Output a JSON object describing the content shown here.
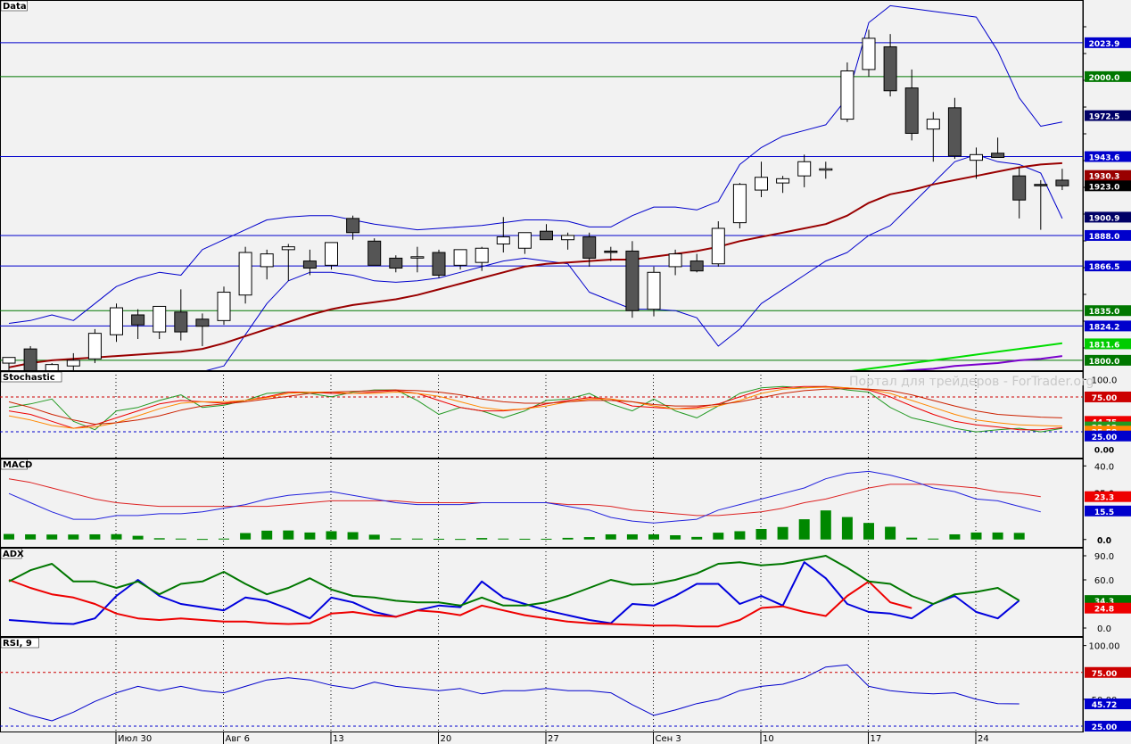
{
  "watermark": "Портал для трейдеров - ForTrader.org",
  "colors": {
    "bg": "#f2f2f2",
    "blue": "#0000cc",
    "green": "#007700",
    "red": "#cc0000",
    "darkred": "#990000",
    "candle_down": "#555555",
    "candle_up": "#ffffff",
    "purple": "#7a00cc",
    "lime": "#00dd00",
    "orange": "#ff8800"
  },
  "x_labels": [
    "Июл 30",
    "Авг 6",
    "13",
    "20",
    "27",
    "Сен 3",
    "10",
    "17",
    "24"
  ],
  "panels": [
    {
      "id": "price",
      "title": "Data",
      "ylim": [
        1793,
        2054
      ],
      "ticks": [],
      "hlines": [
        {
          "v": 2023.9,
          "c": "#0000cc"
        },
        {
          "v": 2000.0,
          "c": "#007700"
        },
        {
          "v": 1943.6,
          "c": "#0000cc"
        },
        {
          "v": 1888.0,
          "c": "#0000cc"
        },
        {
          "v": 1866.5,
          "c": "#0000cc"
        },
        {
          "v": 1835.0,
          "c": "#007700"
        },
        {
          "v": 1824.2,
          "c": "#0000cc"
        },
        {
          "v": 1800.0,
          "c": "#007700"
        }
      ],
      "tags": [
        {
          "text": "2023.9",
          "v": 2023.9,
          "bg": "#0000cc",
          "fg": "#ffffff"
        },
        {
          "text": "2000.0",
          "v": 2000.0,
          "bg": "#007700",
          "fg": "#ffffff"
        },
        {
          "text": "1972.5",
          "v": 1972.5,
          "bg": "#000066",
          "fg": "#ffffff"
        },
        {
          "text": "1943.6",
          "v": 1943.6,
          "bg": "#0000cc",
          "fg": "#ffffff"
        },
        {
          "text": "1930.3",
          "v": 1930.3,
          "bg": "#990000",
          "fg": "#ffffff"
        },
        {
          "text": "1923.0",
          "v": 1923.0,
          "bg": "#000000",
          "fg": "#ffffff"
        },
        {
          "text": "1900.9",
          "v": 1900.9,
          "bg": "#000066",
          "fg": "#ffffff"
        },
        {
          "text": "1888.0",
          "v": 1888.0,
          "bg": "#0000cc",
          "fg": "#ffffff"
        },
        {
          "text": "1866.5",
          "v": 1866.5,
          "bg": "#0000cc",
          "fg": "#ffffff"
        },
        {
          "text": "1835.0",
          "v": 1835.0,
          "bg": "#007700",
          "fg": "#ffffff"
        },
        {
          "text": "1824.2",
          "v": 1824.2,
          "bg": "#0000cc",
          "fg": "#ffffff"
        },
        {
          "text": "1811.6",
          "v": 1811.6,
          "bg": "#00cc00",
          "fg": "#ffffff"
        },
        {
          "text": "1800.0",
          "v": 1800.0,
          "bg": "#007700",
          "fg": "#ffffff"
        }
      ]
    },
    {
      "id": "stoch",
      "title": "Stochastic",
      "ylim": [
        -12,
        112
      ],
      "ticks": [
        {
          "text": "100.0",
          "v": 100
        }
      ],
      "hlines": [
        {
          "v": 75,
          "c": "#cc0000",
          "dash": true
        },
        {
          "v": 25,
          "c": "#0000cc",
          "dash": true
        }
      ],
      "tags": [
        {
          "text": "75.00",
          "v": 75,
          "bg": "#cc0000",
          "fg": "#ffffff"
        },
        {
          "text": "44.75",
          "v": 40,
          "bg": "#ee0000",
          "fg": "#ffffff"
        },
        {
          "text": "33.12",
          "v": 32,
          "bg": "#229922",
          "fg": "#ffffff"
        },
        {
          "text": "25.58",
          "v": 26,
          "bg": "#ff8800",
          "fg": "#ffffff"
        },
        {
          "text": "25.00",
          "v": 19,
          "bg": "#0000cc",
          "fg": "#ffffff"
        },
        {
          "text": "0.00",
          "v": 0,
          "bg": "none",
          "fg": "#000000"
        }
      ]
    },
    {
      "id": "macd",
      "title": "MACD",
      "ylim": [
        -4,
        44
      ],
      "ticks": [
        {
          "text": "40.0",
          "v": 40
        },
        {
          "text": "0.0",
          "v": 0
        }
      ],
      "hlines": [],
      "tags": [
        {
          "text": "25.0",
          "v": 25.5,
          "bg": "none",
          "fg": "#000000"
        },
        {
          "text": "23.3",
          "v": 23.3,
          "bg": "#ee0000",
          "fg": "#ffffff"
        },
        {
          "text": "15.5",
          "v": 15.5,
          "bg": "#0000cc",
          "fg": "#ffffff"
        },
        {
          "text": "0.0",
          "v": 0,
          "bg": "none",
          "fg": "#000000"
        }
      ]
    },
    {
      "id": "adx",
      "title": "ADX",
      "ylim": [
        -10,
        100
      ],
      "ticks": [
        {
          "text": "90.0",
          "v": 90
        },
        {
          "text": "60.0",
          "v": 60
        },
        {
          "text": "0.0",
          "v": 0
        }
      ],
      "hlines": [],
      "tags": [
        {
          "text": "34.3",
          "v": 34.3,
          "bg": "#007700",
          "fg": "#ffffff"
        },
        {
          "text": "24.8",
          "v": 24.8,
          "bg": "#ee0000",
          "fg": "#ffffff"
        }
      ]
    },
    {
      "id": "rsi",
      "title": "RSI, 9",
      "ylim": [
        20,
        108
      ],
      "ticks": [
        {
          "text": "100.00",
          "v": 100
        },
        {
          "text": "50.00",
          "v": 50
        }
      ],
      "hlines": [
        {
          "v": 75,
          "c": "#cc0000",
          "dash": true
        },
        {
          "v": 25,
          "c": "#0000cc",
          "dash": true
        }
      ],
      "tags": [
        {
          "text": "75.00",
          "v": 75,
          "bg": "#cc0000",
          "fg": "#ffffff"
        },
        {
          "text": "45.72",
          "v": 45.72,
          "bg": "#0000cc",
          "fg": "#ffffff"
        },
        {
          "text": "25.00",
          "v": 25,
          "bg": "#0000cc",
          "fg": "#ffffff"
        }
      ]
    }
  ],
  "chart_data": {
    "type": "line",
    "title": "Data",
    "instrument_last": 1923.0,
    "candles": [
      {
        "o": 1798,
        "h": 1802,
        "l": 1790,
        "c": 1802
      },
      {
        "o": 1808,
        "h": 1810,
        "l": 1785,
        "c": 1786
      },
      {
        "o": 1783,
        "h": 1798,
        "l": 1780,
        "c": 1797
      },
      {
        "o": 1796,
        "h": 1805,
        "l": 1790,
        "c": 1800
      },
      {
        "o": 1801,
        "h": 1822,
        "l": 1798,
        "c": 1819
      },
      {
        "o": 1818,
        "h": 1840,
        "l": 1813,
        "c": 1837
      },
      {
        "o": 1832,
        "h": 1836,
        "l": 1815,
        "c": 1825
      },
      {
        "o": 1820,
        "h": 1838,
        "l": 1815,
        "c": 1838
      },
      {
        "o": 1834,
        "h": 1850,
        "l": 1814,
        "c": 1820
      },
      {
        "o": 1829,
        "h": 1833,
        "l": 1810,
        "c": 1824
      },
      {
        "o": 1828,
        "h": 1852,
        "l": 1825,
        "c": 1848
      },
      {
        "o": 1846,
        "h": 1880,
        "l": 1840,
        "c": 1876
      },
      {
        "o": 1866,
        "h": 1878,
        "l": 1857,
        "c": 1875
      },
      {
        "o": 1878,
        "h": 1882,
        "l": 1856,
        "c": 1880
      },
      {
        "o": 1870,
        "h": 1878,
        "l": 1860,
        "c": 1865
      },
      {
        "o": 1867,
        "h": 1883,
        "l": 1864,
        "c": 1883
      },
      {
        "o": 1900,
        "h": 1902,
        "l": 1885,
        "c": 1890
      },
      {
        "o": 1884,
        "h": 1886,
        "l": 1867,
        "c": 1867
      },
      {
        "o": 1872,
        "h": 1874,
        "l": 1862,
        "c": 1865
      },
      {
        "o": 1873,
        "h": 1880,
        "l": 1862,
        "c": 1873
      },
      {
        "o": 1876,
        "h": 1878,
        "l": 1858,
        "c": 1860
      },
      {
        "o": 1867,
        "h": 1878,
        "l": 1864,
        "c": 1878
      },
      {
        "o": 1869,
        "h": 1880,
        "l": 1863,
        "c": 1879
      },
      {
        "o": 1882,
        "h": 1901,
        "l": 1876,
        "c": 1887
      },
      {
        "o": 1879,
        "h": 1890,
        "l": 1875,
        "c": 1890
      },
      {
        "o": 1891,
        "h": 1896,
        "l": 1885,
        "c": 1885
      },
      {
        "o": 1885,
        "h": 1890,
        "l": 1878,
        "c": 1888
      },
      {
        "o": 1887,
        "h": 1890,
        "l": 1866,
        "c": 1872
      },
      {
        "o": 1877,
        "h": 1880,
        "l": 1870,
        "c": 1876
      },
      {
        "o": 1877,
        "h": 1884,
        "l": 1830,
        "c": 1835
      },
      {
        "o": 1836,
        "h": 1866,
        "l": 1831,
        "c": 1862
      },
      {
        "o": 1866,
        "h": 1878,
        "l": 1860,
        "c": 1875
      },
      {
        "o": 1870,
        "h": 1875,
        "l": 1862,
        "c": 1863
      },
      {
        "o": 1868,
        "h": 1898,
        "l": 1866,
        "c": 1893
      },
      {
        "o": 1897,
        "h": 1925,
        "l": 1893,
        "c": 1924
      },
      {
        "o": 1920,
        "h": 1940,
        "l": 1915,
        "c": 1929
      },
      {
        "o": 1925,
        "h": 1930,
        "l": 1918,
        "c": 1928
      },
      {
        "o": 1930,
        "h": 1945,
        "l": 1922,
        "c": 1940
      },
      {
        "o": 1935,
        "h": 1940,
        "l": 1928,
        "c": 1935
      },
      {
        "o": 1970,
        "h": 2010,
        "l": 1968,
        "c": 2004
      },
      {
        "o": 2005,
        "h": 2033,
        "l": 2000,
        "c": 2027
      },
      {
        "o": 2021,
        "h": 2030,
        "l": 1986,
        "c": 1990
      },
      {
        "o": 1992,
        "h": 2005,
        "l": 1955,
        "c": 1960
      },
      {
        "o": 1963,
        "h": 1975,
        "l": 1940,
        "c": 1970
      },
      {
        "o": 1978,
        "h": 1985,
        "l": 1942,
        "c": 1944
      },
      {
        "o": 1941,
        "h": 1950,
        "l": 1928,
        "c": 1945
      },
      {
        "o": 1946,
        "h": 1957,
        "l": 1943,
        "c": 1943
      },
      {
        "o": 1930,
        "h": 1936,
        "l": 1900,
        "c": 1913
      },
      {
        "o": 1924,
        "h": 1927,
        "l": 1892,
        "c": 1923
      },
      {
        "o": 1927,
        "h": 1935,
        "l": 1920,
        "c": 1923
      }
    ],
    "ma_red": [
      1795,
      1798,
      1800,
      1801,
      1802,
      1803,
      1804,
      1805,
      1806,
      1808,
      1812,
      1817,
      1822,
      1827,
      1832,
      1836,
      1839,
      1841,
      1843,
      1846,
      1850,
      1854,
      1858,
      1862,
      1866,
      1868,
      1869,
      1870,
      1871,
      1871,
      1873,
      1875,
      1877,
      1880,
      1884,
      1887,
      1890,
      1893,
      1896,
      1902,
      1911,
      1917,
      1920,
      1924,
      1927,
      1930,
      1933,
      1936,
      1938,
      1939
    ],
    "bb_upper": [
      1826,
      1828,
      1832,
      1828,
      1840,
      1852,
      1858,
      1862,
      1860,
      1878,
      1885,
      1892,
      1899,
      1901,
      1902,
      1902,
      1899,
      1896,
      1894,
      1892,
      1893,
      1894,
      1895,
      1897,
      1899,
      1899,
      1898,
      1894,
      1894,
      1902,
      1908,
      1908,
      1906,
      1912,
      1938,
      1950,
      1958,
      1962,
      1966,
      1985,
      2038,
      2050,
      2048,
      2046,
      2044,
      2042,
      2018,
      1985,
      1965,
      1968
    ],
    "bb_lower": [
      1748,
      1752,
      1756,
      1760,
      1770,
      1778,
      1784,
      1786,
      1785,
      1792,
      1796,
      1818,
      1840,
      1856,
      1862,
      1862,
      1860,
      1856,
      1855,
      1856,
      1858,
      1862,
      1866,
      1870,
      1872,
      1870,
      1868,
      1848,
      1842,
      1836,
      1836,
      1835,
      1830,
      1810,
      1822,
      1840,
      1850,
      1860,
      1870,
      1876,
      1888,
      1895,
      1910,
      1925,
      1940,
      1945,
      1940,
      1938,
      1932,
      1900
    ],
    "ma_green_tail": [
      1792,
      1794,
      1796,
      1798,
      1800,
      1802,
      1804,
      1806,
      1808,
      1810,
      1812
    ],
    "ma_purple_tail": [
      1786,
      1788,
      1789,
      1790,
      1792,
      1793,
      1794,
      1796,
      1797,
      1798,
      1800,
      1801,
      1803
    ],
    "stoch_k": [
      60,
      65,
      72,
      40,
      28,
      55,
      60,
      70,
      78,
      60,
      63,
      70,
      80,
      82,
      80,
      75,
      82,
      85,
      85,
      70,
      50,
      60,
      55,
      45,
      55,
      70,
      72,
      80,
      65,
      55,
      72,
      55,
      45,
      62,
      80,
      88,
      90,
      88,
      90,
      85,
      82,
      60,
      45,
      38,
      30,
      25,
      28,
      30,
      25,
      30
    ],
    "stoch_d": [
      55,
      50,
      40,
      30,
      35,
      45,
      55,
      65,
      70,
      68,
      66,
      70,
      75,
      82,
      82,
      80,
      80,
      82,
      84,
      80,
      70,
      60,
      55,
      55,
      58,
      65,
      70,
      74,
      72,
      62,
      60,
      58,
      60,
      65,
      75,
      85,
      88,
      90,
      90,
      88,
      85,
      75,
      62,
      50,
      40,
      35,
      32,
      28,
      28,
      31
    ],
    "stoch_slow1": [
      48,
      42,
      34,
      30,
      32,
      38,
      48,
      58,
      66,
      68,
      68,
      70,
      74,
      80,
      82,
      82,
      80,
      80,
      82,
      80,
      76,
      68,
      60,
      56,
      58,
      62,
      68,
      72,
      72,
      68,
      62,
      58,
      58,
      62,
      70,
      80,
      86,
      88,
      89,
      88,
      86,
      80,
      70,
      60,
      50,
      42,
      38,
      35,
      34,
      33
    ],
    "stoch_slow2": [
      68,
      60,
      50,
      42,
      36,
      38,
      42,
      48,
      56,
      62,
      65,
      68,
      72,
      76,
      80,
      82,
      83,
      84,
      85,
      84,
      82,
      78,
      72,
      68,
      66,
      66,
      68,
      70,
      70,
      68,
      64,
      62,
      62,
      64,
      68,
      74,
      80,
      84,
      86,
      87,
      86,
      84,
      78,
      70,
      62,
      55,
      50,
      48,
      46,
      45
    ],
    "macd_main": [
      25,
      20,
      15,
      11,
      11,
      13,
      13,
      14,
      14,
      15,
      17,
      19,
      22,
      24,
      25,
      26,
      24,
      22,
      20,
      19,
      19,
      19,
      20,
      20,
      20,
      20,
      18,
      16,
      12,
      10,
      9,
      10,
      11,
      16,
      19,
      22,
      25,
      28,
      33,
      36,
      37,
      35,
      32,
      28,
      26,
      22,
      21,
      18,
      15
    ],
    "macd_signal": [
      33,
      31,
      28,
      25,
      22,
      20,
      19,
      18,
      18,
      18,
      18,
      18,
      18,
      19,
      20,
      21,
      21,
      21,
      21,
      20,
      20,
      20,
      20,
      20,
      20,
      20,
      19,
      19,
      18,
      16,
      15,
      14,
      13,
      13,
      14,
      15,
      17,
      20,
      22,
      25,
      28,
      30,
      30,
      30,
      29,
      28,
      26,
      25,
      23.3
    ],
    "macd_hist": [
      3,
      2.8,
      2.7,
      2.7,
      2.8,
      2.9,
      2.0,
      0.7,
      0.5,
      0.3,
      0.5,
      3.5,
      4.8,
      4.9,
      3.8,
      4.5,
      4.0,
      2.6,
      0.6,
      0.5,
      0.4,
      0.3,
      0.8,
      0.5,
      0.4,
      0.4,
      0.9,
      1.3,
      2.8,
      2.8,
      2.8,
      2.3,
      1.4,
      3.7,
      4.5,
      5.7,
      6.8,
      11,
      15.8,
      12.2,
      9.0,
      6.9,
      1.0,
      0.5,
      2.8,
      3.8,
      3.8,
      3.6
    ],
    "adx_main": [
      58,
      72,
      80,
      58,
      58,
      50,
      58,
      42,
      55,
      58,
      70,
      55,
      42,
      50,
      62,
      48,
      40,
      38,
      34,
      32,
      32,
      28,
      38,
      28,
      28,
      32,
      40,
      50,
      60,
      54,
      55,
      60,
      68,
      80,
      82,
      78,
      80,
      85,
      90,
      75,
      58,
      55,
      40,
      30,
      42,
      45,
      50,
      34.3
    ],
    "adx_plus": [
      60,
      50,
      42,
      38,
      30,
      18,
      12,
      10,
      12,
      10,
      8,
      8,
      6,
      5,
      6,
      18,
      20,
      16,
      14,
      22,
      20,
      16,
      28,
      22,
      16,
      12,
      8,
      6,
      5,
      4,
      3,
      3,
      2,
      2,
      10,
      25,
      27,
      20,
      15,
      40,
      58,
      32,
      24.8
    ],
    "adx_minus": [
      10,
      8,
      6,
      5,
      12,
      40,
      60,
      40,
      30,
      26,
      22,
      38,
      34,
      24,
      12,
      38,
      32,
      20,
      14,
      22,
      28,
      26,
      58,
      38,
      30,
      22,
      16,
      10,
      6,
      30,
      28,
      40,
      55,
      55,
      30,
      40,
      28,
      82,
      62,
      30,
      20,
      18,
      12,
      30,
      40,
      20,
      12,
      34.3
    ],
    "rsi": [
      42,
      35,
      30,
      38,
      48,
      56,
      62,
      58,
      62,
      58,
      56,
      62,
      68,
      70,
      68,
      63,
      60,
      66,
      62,
      60,
      58,
      60,
      55,
      58,
      58,
      60,
      58,
      58,
      56,
      45,
      35,
      40,
      46,
      50,
      58,
      62,
      64,
      70,
      80,
      82,
      62,
      58,
      56,
      55,
      56,
      50,
      46,
      45.72
    ]
  }
}
